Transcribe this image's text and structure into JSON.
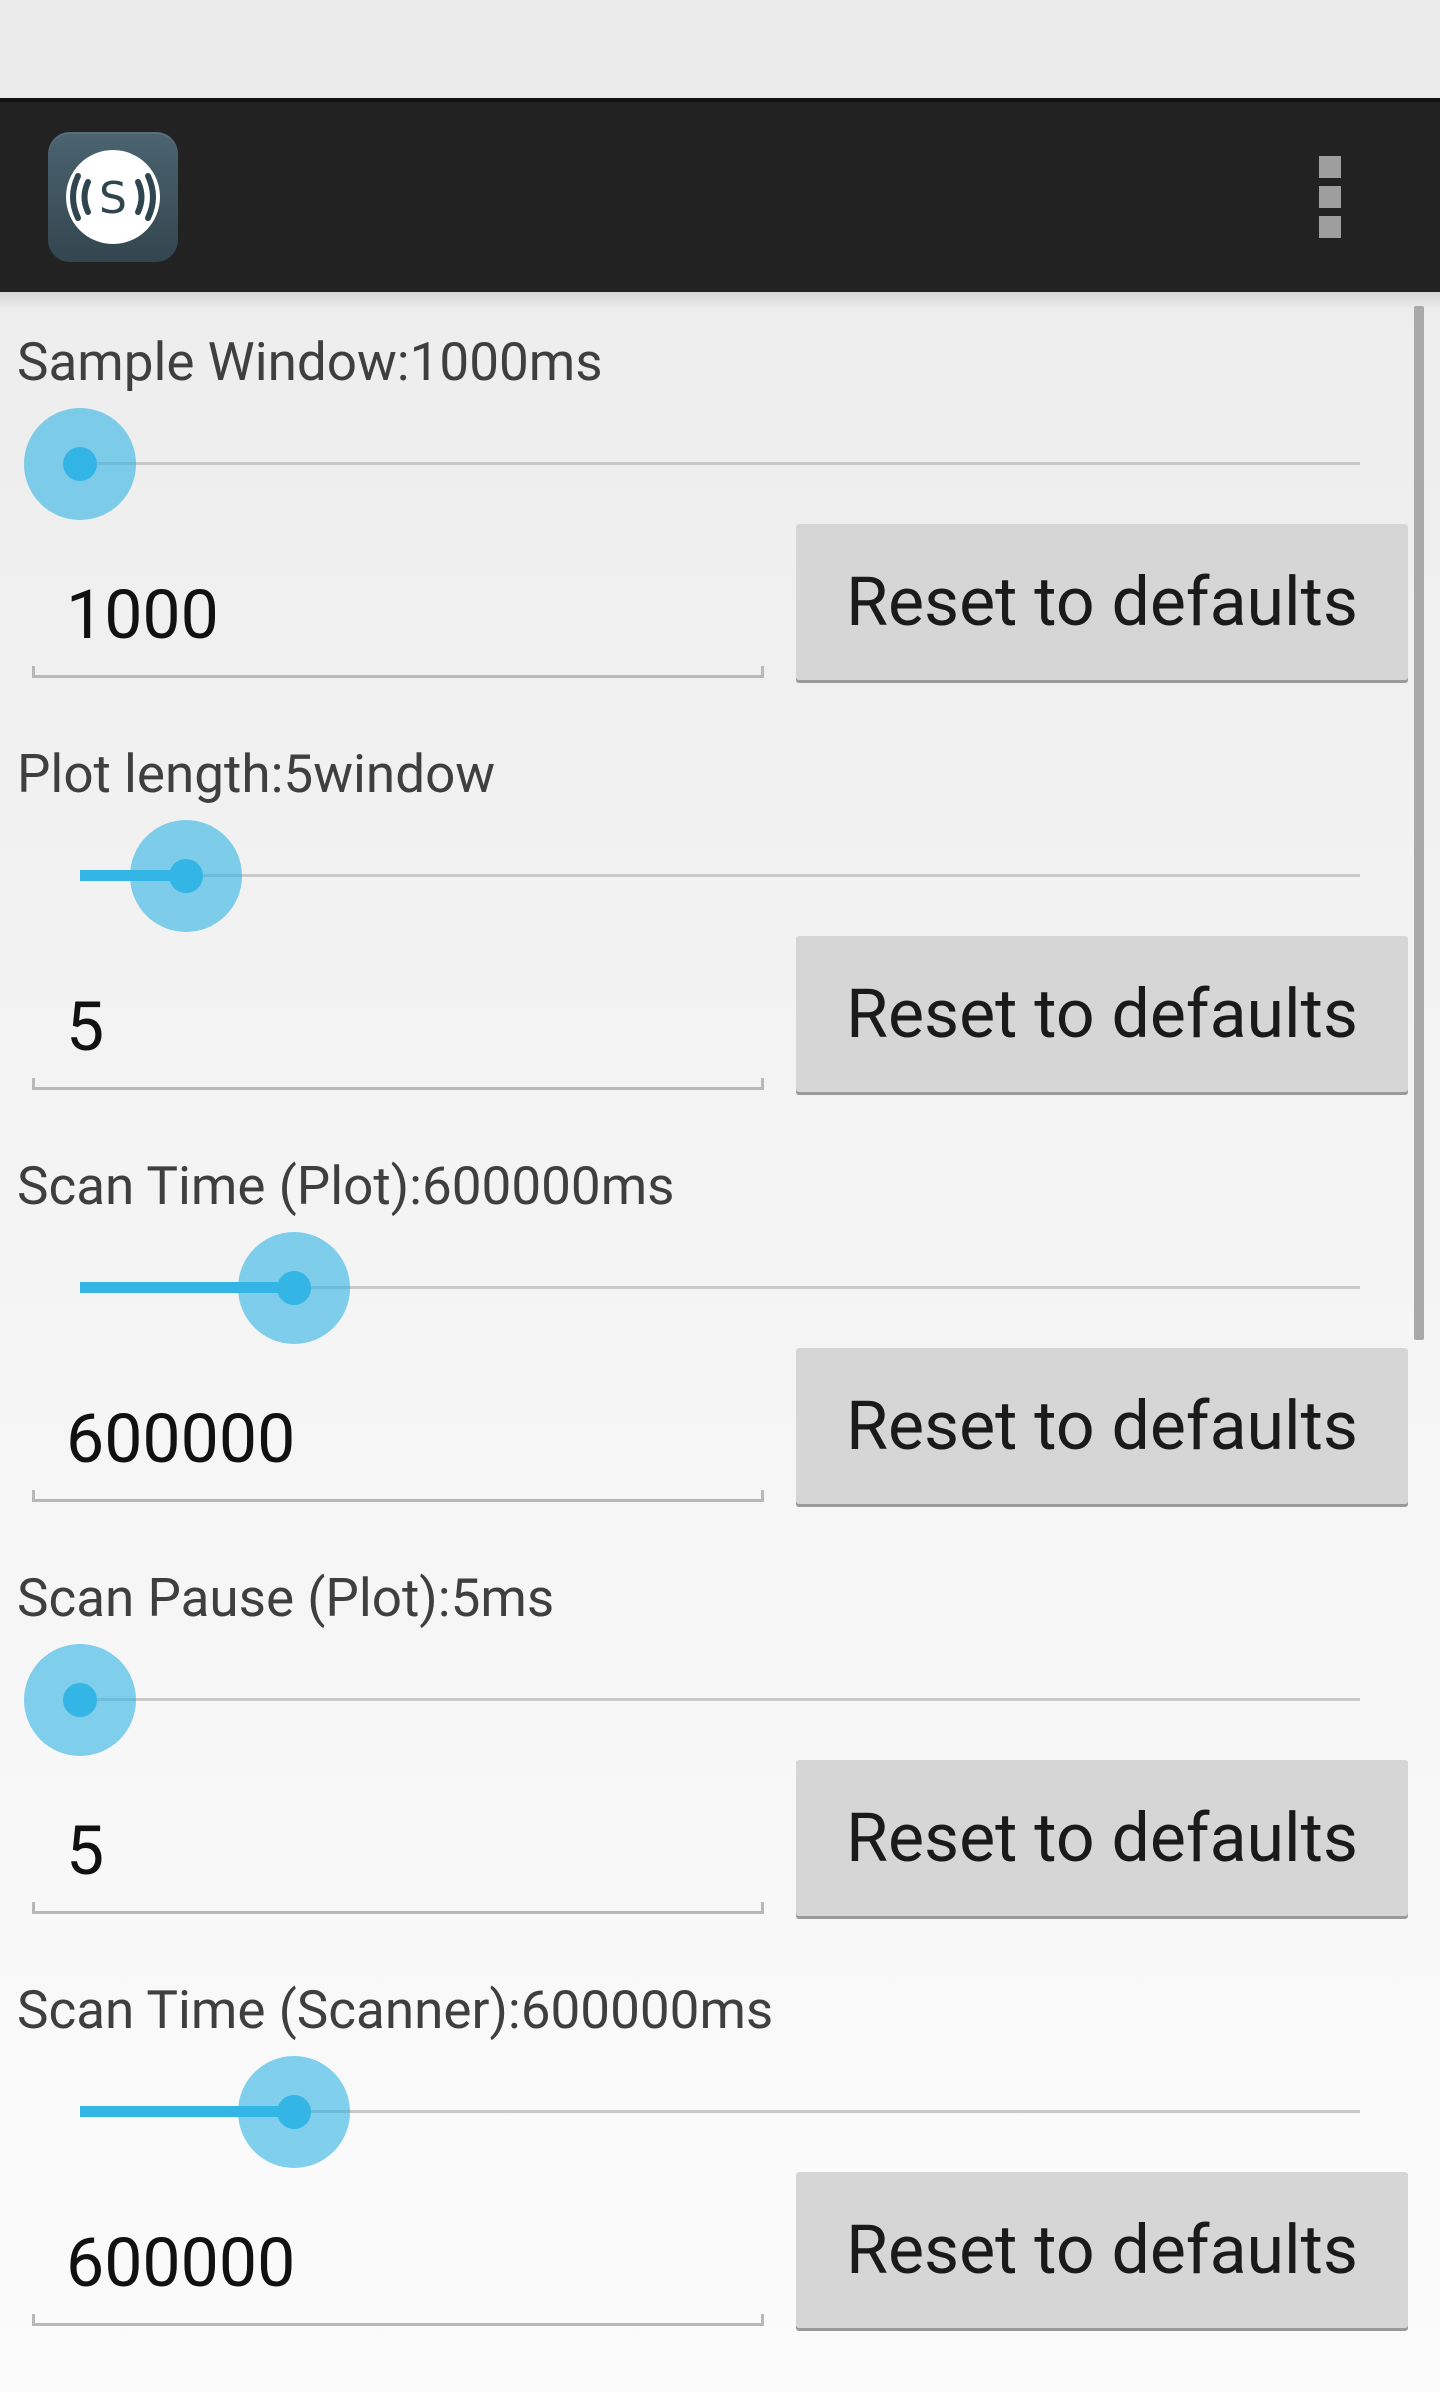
{
  "colors": {
    "accent": "#33b5e5",
    "action_bar": "#222222",
    "button_bg": "#d6d6d6"
  },
  "action_bar": {
    "app_icon": "signal-s-icon",
    "overflow_icon": "overflow-menu-icon"
  },
  "settings": [
    {
      "id": "sample-window",
      "label": "Sample Window:1000ms",
      "slider_value_fraction": 0.0,
      "value": "1000",
      "reset_label": "Reset to defaults"
    },
    {
      "id": "plot-length",
      "label": "Plot length:5window",
      "slider_value_fraction": 0.083,
      "value": "5",
      "reset_label": "Reset to defaults"
    },
    {
      "id": "scan-time-plot",
      "label": "Scan Time (Plot):600000ms",
      "slider_value_fraction": 0.167,
      "value": "600000",
      "reset_label": "Reset to defaults"
    },
    {
      "id": "scan-pause-plot",
      "label": "Scan Pause (Plot):5ms",
      "slider_value_fraction": 0.0,
      "value": "5",
      "reset_label": "Reset to defaults"
    },
    {
      "id": "scan-time-scanner",
      "label": "Scan Time (Scanner):600000ms",
      "slider_value_fraction": 0.167,
      "value": "600000",
      "reset_label": "Reset to defaults"
    }
  ]
}
